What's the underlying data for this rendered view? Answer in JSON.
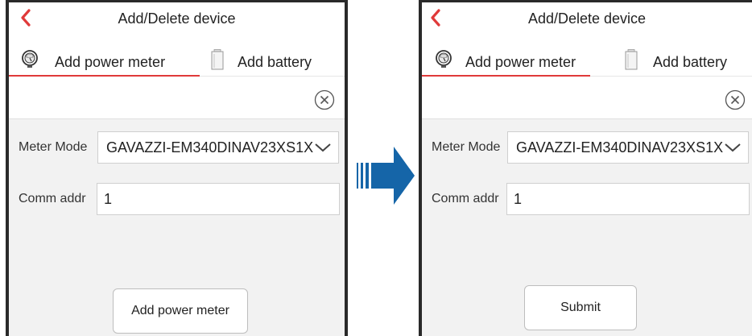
{
  "left": {
    "title": "Add/Delete device",
    "tabs": [
      {
        "label": "Add power meter",
        "icon": "power-meter-icon",
        "active": true
      },
      {
        "label": "Add battery",
        "icon": "battery-icon",
        "active": false
      }
    ],
    "meter_mode": {
      "label": "Meter Mode",
      "value": "GAVAZZI-EM340DINAV23XS1X"
    },
    "comm_addr": {
      "label": "Comm addr",
      "value": "1"
    },
    "action_button": "Add power meter"
  },
  "right": {
    "title": "Add/Delete device",
    "tabs": [
      {
        "label": "Add power meter",
        "icon": "power-meter-icon",
        "active": true
      },
      {
        "label": "Add battery",
        "icon": "battery-icon",
        "active": false
      }
    ],
    "meter_mode": {
      "label": "Meter Mode",
      "value": "GAVAZZI-EM340DINAV23XS1X"
    },
    "comm_addr": {
      "label": "Comm addr",
      "value": "1"
    },
    "action_button": "Submit"
  },
  "colors": {
    "accent_red": "#e03a3a",
    "arrow_blue": "#1565a8",
    "background_gray": "#f2f2f2"
  }
}
